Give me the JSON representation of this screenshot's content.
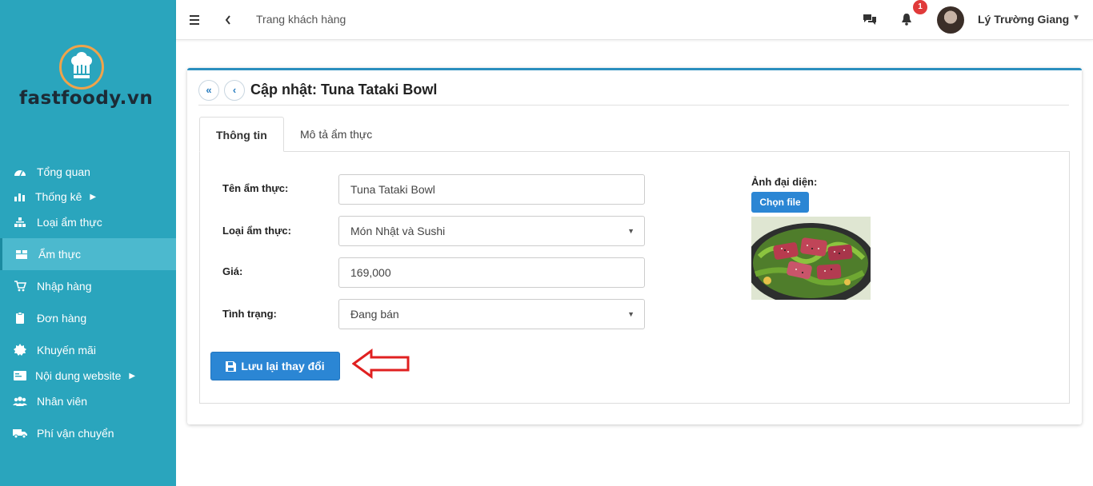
{
  "brand": {
    "name": "fastfoody.vn"
  },
  "sidebar": {
    "items": [
      {
        "label": "Tổng quan",
        "icon": "dashboard-icon",
        "active": false,
        "submenu": false
      },
      {
        "label": "Thống kê",
        "icon": "bar-chart-icon",
        "active": false,
        "submenu": true
      },
      {
        "label": "Loại ẩm thực",
        "icon": "sitemap-icon",
        "active": false,
        "submenu": false
      },
      {
        "label": "Ẩm thực",
        "icon": "box-icon",
        "active": true,
        "submenu": false
      },
      {
        "label": "Nhập hàng",
        "icon": "cart-icon",
        "active": false,
        "submenu": false
      },
      {
        "label": "Đơn hàng",
        "icon": "clipboard-icon",
        "active": false,
        "submenu": false
      },
      {
        "label": "Khuyến mãi",
        "icon": "gear-badge-icon",
        "active": false,
        "submenu": false
      },
      {
        "label": "Nội dung website",
        "icon": "id-card-icon",
        "active": false,
        "submenu": true
      },
      {
        "label": "Nhân viên",
        "icon": "users-icon",
        "active": false,
        "submenu": false
      },
      {
        "label": "Phí vận chuyển",
        "icon": "truck-icon",
        "active": false,
        "submenu": false
      }
    ]
  },
  "topbar": {
    "title": "Trang khách hàng",
    "notification_count": "1",
    "user_name": "Lý Trường Giang"
  },
  "page": {
    "title": "Cập nhật: Tuna Tataki Bowl",
    "tabs": [
      {
        "label": "Thông tin",
        "active": true
      },
      {
        "label": "Mô tả ẩm thực",
        "active": false
      }
    ]
  },
  "form": {
    "name_label": "Tên ẩm thực:",
    "name_value": "Tuna Tataki Bowl",
    "category_label": "Loại ẩm thực:",
    "category_value": "Món Nhật và Sushi",
    "price_label": "Giá:",
    "price_value": "169,000",
    "status_label": "Tình trạng:",
    "status_value": "Đang bán",
    "save_label": "Lưu lại thay đổi",
    "avatar_label": "Ảnh đại diện:",
    "choose_file_label": "Chọn file"
  },
  "colors": {
    "sidebar_bg": "#2aa5bd",
    "sidebar_active": "#4cb9ce",
    "primary_button": "#2b86d4",
    "badge": "#e03a3a",
    "annotation_arrow": "#e02020"
  }
}
